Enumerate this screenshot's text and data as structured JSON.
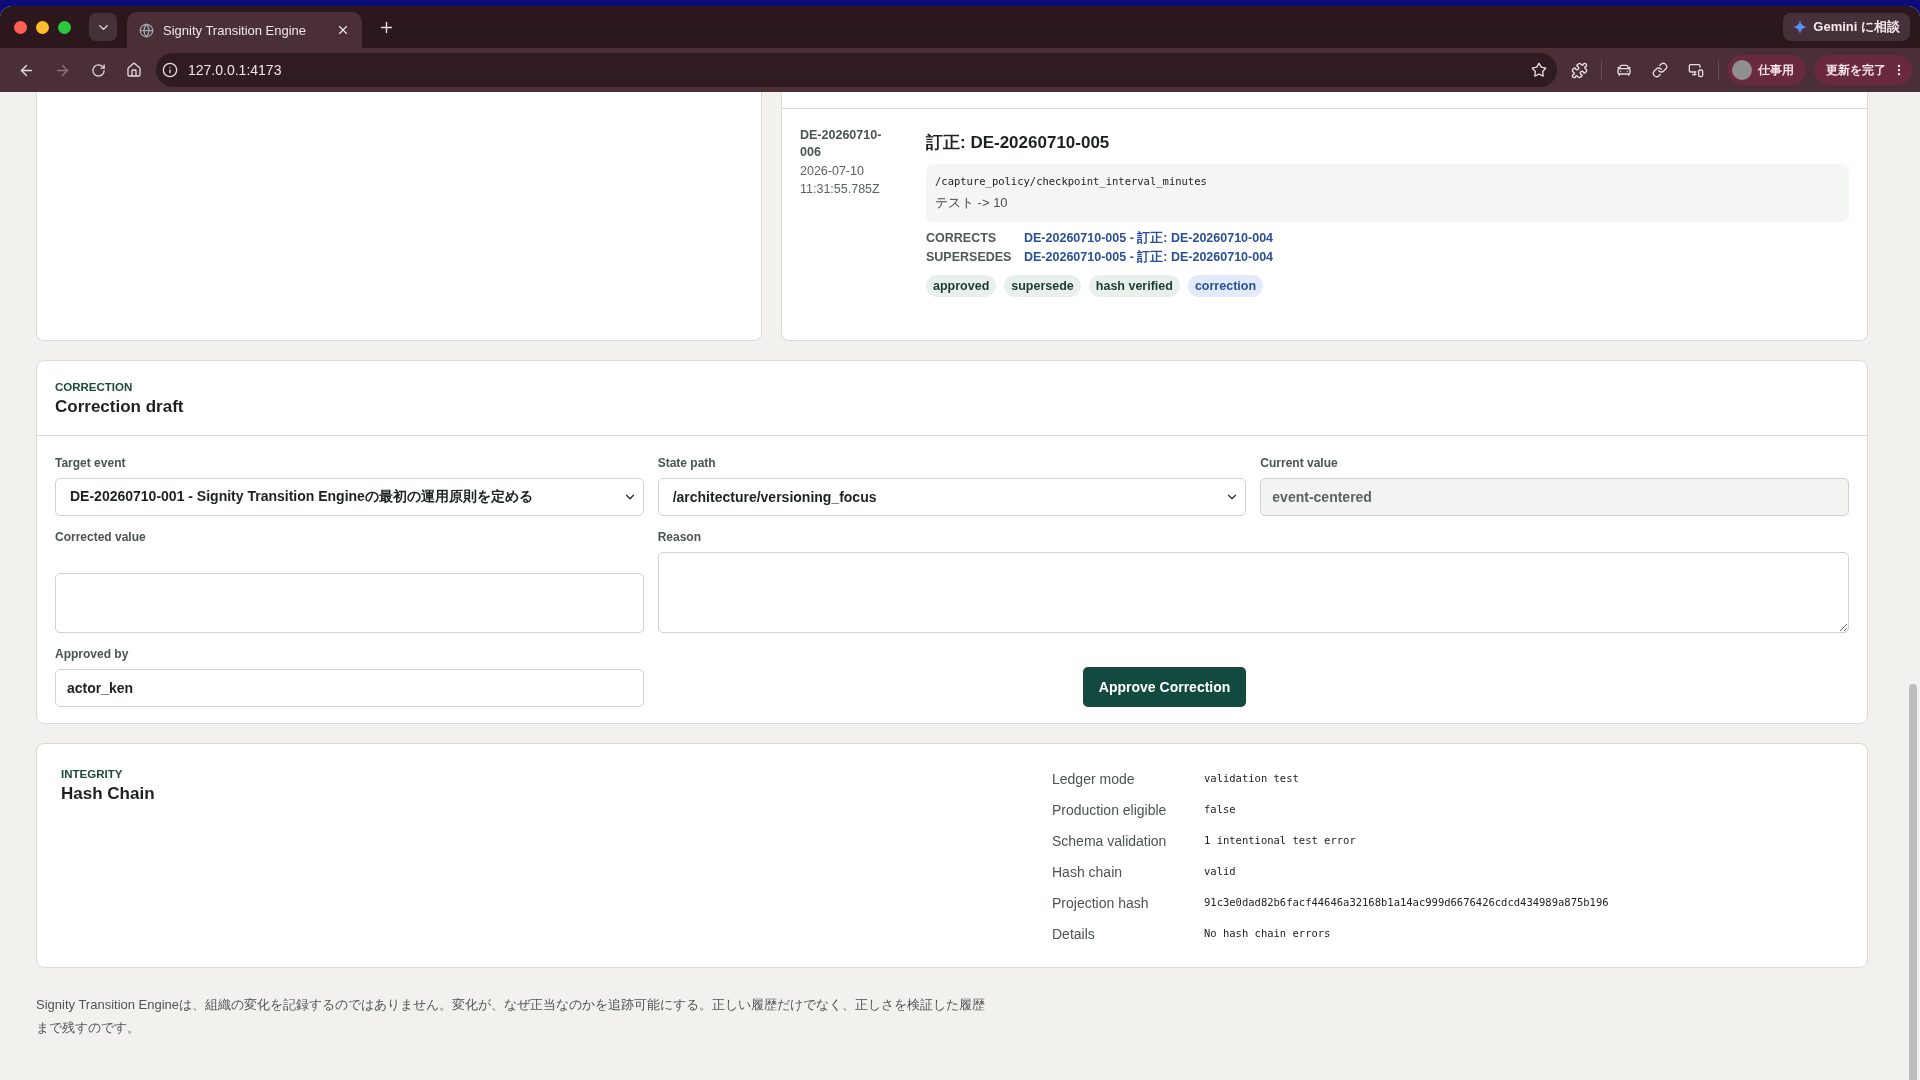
{
  "browser": {
    "tab_title": "Signity Transition Engine",
    "url": "127.0.0.1:4173",
    "assistant_label": "Gemini に相談",
    "profile_label": "仕事用",
    "update_label": "更新を完了"
  },
  "events": [
    {
      "id": "DE-20260710-006",
      "timestamp": "2026-07-10 11:31:55.785Z",
      "title": "訂正: DE-20260710-005",
      "path": "/capture_policy/checkpoint_interval_minutes",
      "change": "テスト -> 10",
      "relations": [
        {
          "label": "CORRECTS",
          "link": "DE-20260710-005 - 訂正: DE-20260710-004"
        },
        {
          "label": "SUPERSEDES",
          "link": "DE-20260710-005 - 訂正: DE-20260710-004"
        }
      ],
      "tags": [
        {
          "label": "approved",
          "kind": "status"
        },
        {
          "label": "supersede",
          "kind": "status"
        },
        {
          "label": "hash verified",
          "kind": "status"
        },
        {
          "label": "correction",
          "kind": "type"
        }
      ]
    }
  ],
  "correction": {
    "section_label": "CORRECTION",
    "title": "Correction draft",
    "fields": [
      {
        "label": "Target event",
        "kind": "select",
        "value": "DE-20260710-001 - Signity Transition Engineの最初の運用原則を定める"
      },
      {
        "label": "State path",
        "kind": "select",
        "value": "/architecture/versioning_focus"
      },
      {
        "label": "Current value",
        "kind": "readonly",
        "value": "event-centered"
      },
      {
        "label": "Corrected value",
        "kind": "input"
      },
      {
        "label": "Reason",
        "kind": "textarea"
      },
      {
        "label": "Approved by",
        "kind": "input",
        "value": "actor_ken"
      }
    ],
    "button": "Approve Correction"
  },
  "integrity": {
    "section_label": "INTEGRITY",
    "title": "Hash Chain",
    "rows": [
      {
        "label": "Ledger mode",
        "value": "validation test"
      },
      {
        "label": "Production eligible",
        "value": "false"
      },
      {
        "label": "Schema validation",
        "value": "1 intentional test error"
      },
      {
        "label": "Hash chain",
        "value": "valid"
      },
      {
        "label": "Projection hash",
        "value": "91c3e0dad82b6facf44646a32168b1a14ac999d6676426cdcd434989a875b196"
      },
      {
        "label": "Details",
        "value": "No hash chain errors"
      }
    ]
  },
  "footer": "Signity Transition Engineは、組織の変化を記録するのではありません。変化が、なぜ正当なのかを追跡可能にする。正しい履歴だけでなく、正しさを検証した履歴まで残すのです。"
}
